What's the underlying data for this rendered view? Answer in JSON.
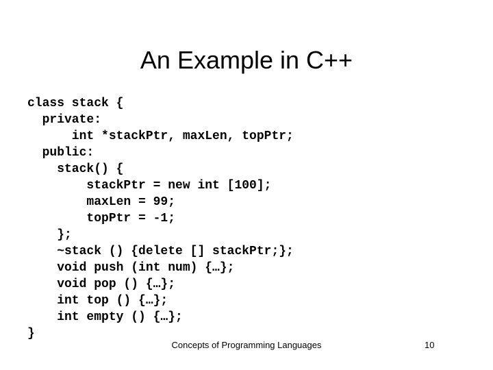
{
  "slide": {
    "title": "An Example in C++",
    "background_color": "#ffffff",
    "text_color": "#000000"
  },
  "code": {
    "language": "C++",
    "lines": [
      "class stack {",
      "  private:",
      "      int *stackPtr, maxLen, topPtr;",
      "  public:",
      "    stack() {",
      "        stackPtr = new int [100];",
      "        maxLen = 99;",
      "        topPtr = -1;",
      "    };",
      "    ~stack () {delete [] stackPtr;};",
      "    void push (int num) {…};",
      "    void pop () {…};",
      "    int top () {…};",
      "    int empty () {…};",
      "}"
    ]
  },
  "footer": {
    "center_text": "Concepts of Programming Languages",
    "slide_number": "10"
  }
}
